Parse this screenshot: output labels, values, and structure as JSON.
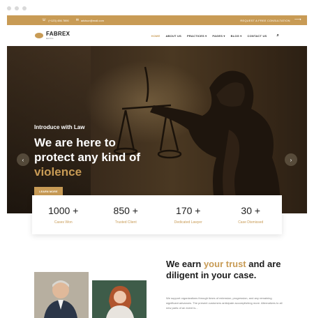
{
  "topbar": {
    "phone": "(+123) 456 7890",
    "email": "advisor@mail.com",
    "cta": "REQUEST A FREE CONSULTATION"
  },
  "brand": {
    "name": "FABREX",
    "tagline": "law firm"
  },
  "menu": [
    {
      "label": "HOME",
      "active": true
    },
    {
      "label": "ABOUT US"
    },
    {
      "label": "PRACTICES ▾"
    },
    {
      "label": "PAGES ▾"
    },
    {
      "label": "BLOG ▾"
    },
    {
      "label": "CONTACT US"
    }
  ],
  "hero": {
    "kicker": "Introduce with Law",
    "title_line1": "We are here to",
    "title_line2": "protect any kind of",
    "title_highlight": "violence",
    "button": "LEARN MORE"
  },
  "stats": [
    {
      "num": "1000 +",
      "label": "Cases Won"
    },
    {
      "num": "850 +",
      "label": "Trusted Client"
    },
    {
      "num": "170 +",
      "label": "Dedicated Lawyer"
    },
    {
      "num": "30 +",
      "label": "Case Dismissed"
    }
  ],
  "about": {
    "title_pre": "We earn ",
    "title_hl": "your trust",
    "title_post": " and are diligent in your case.",
    "text": "We support organizations through times of extension, progression, and any remaining significant advances. The present customers anticipate accomplishing more. Alternatives to all new parts of an event is..."
  },
  "colors": {
    "accent": "#c89b55"
  }
}
